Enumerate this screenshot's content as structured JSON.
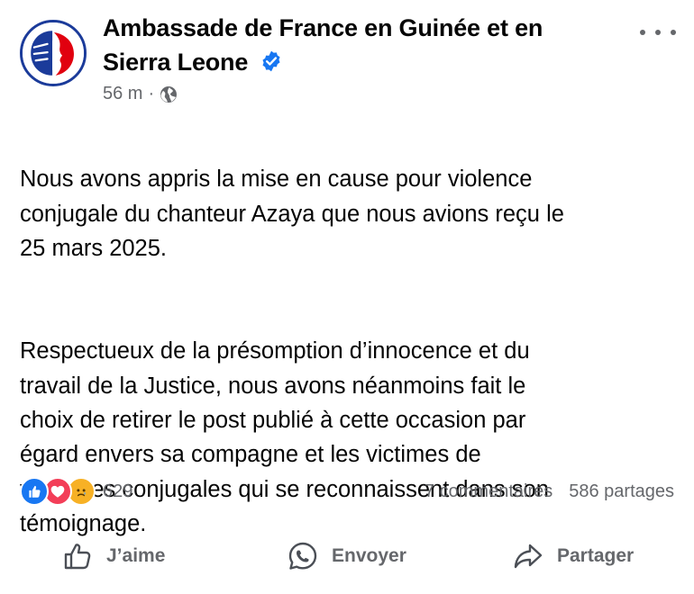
{
  "post": {
    "page_name": "Ambassade de France en Guinée et en Sierra Leone",
    "time_ago": "56 m",
    "separator": "·",
    "paragraphs": [
      "Nous avons appris la mise en cause pour violence\nconjugale du chanteur Azaya que nous avions reçu le\n25 mars 2025.",
      "Respectueux de la présomption d’innocence et du\ntravail de la Justice, nous avons néanmoins fait le\nchoix de retirer le post publié à cette occasion par\négard envers sa compagne et les victimes de\nviolences conjugales qui se reconnaissent dans son\ntémoignage."
    ]
  },
  "reactions": {
    "types": [
      "like",
      "love",
      "sad"
    ],
    "count": "629",
    "comments": "7 commentaires",
    "shares": "586 partages"
  },
  "actions": {
    "like_label": "J’aime",
    "send_label": "Envoyer",
    "share_label": "Partager"
  },
  "icons": {
    "avatar": "marianne-logo-icon",
    "verified": "verified-badge-icon",
    "audience": "globe-icon",
    "more": "more-options-icon"
  },
  "colors": {
    "verified_blue": "#1877f2",
    "secondary_text": "#65676b",
    "logo_blue": "#1b3b9a",
    "logo_red": "#e1000f"
  }
}
